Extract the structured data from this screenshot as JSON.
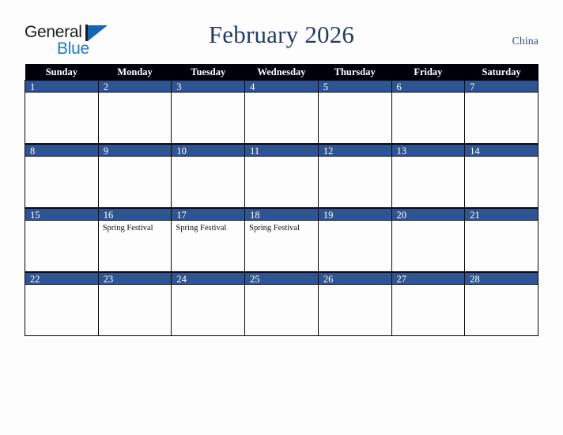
{
  "brand": {
    "word_one": "General",
    "word_two": "Blue",
    "mark_icon": "triangle-logo-icon",
    "color_dark": "#1b1b1b",
    "color_blue": "#1f7ac4",
    "mark_color": "#1565b0"
  },
  "header": {
    "title": "February 2026",
    "country": "China",
    "title_color": "#243b66",
    "country_color": "#3c4f74"
  },
  "calendar": {
    "weekday_headers": [
      "Sunday",
      "Monday",
      "Tuesday",
      "Wednesday",
      "Thursday",
      "Friday",
      "Saturday"
    ],
    "header_bg": "#00000a",
    "header_text_color": "#ffffff",
    "day_band_bg": "#2e5494",
    "day_band_text_color": "#ffffff",
    "cell_bg": "#fdfdfd",
    "border_color": "#0a0a0a",
    "weeks": [
      [
        {
          "day": "1",
          "events": []
        },
        {
          "day": "2",
          "events": []
        },
        {
          "day": "3",
          "events": []
        },
        {
          "day": "4",
          "events": []
        },
        {
          "day": "5",
          "events": []
        },
        {
          "day": "6",
          "events": []
        },
        {
          "day": "7",
          "events": []
        }
      ],
      [
        {
          "day": "8",
          "events": []
        },
        {
          "day": "9",
          "events": []
        },
        {
          "day": "10",
          "events": []
        },
        {
          "day": "11",
          "events": []
        },
        {
          "day": "12",
          "events": []
        },
        {
          "day": "13",
          "events": []
        },
        {
          "day": "14",
          "events": []
        }
      ],
      [
        {
          "day": "15",
          "events": []
        },
        {
          "day": "16",
          "events": [
            "Spring Festival"
          ]
        },
        {
          "day": "17",
          "events": [
            "Spring Festival"
          ]
        },
        {
          "day": "18",
          "events": [
            "Spring Festival"
          ]
        },
        {
          "day": "19",
          "events": []
        },
        {
          "day": "20",
          "events": []
        },
        {
          "day": "21",
          "events": []
        }
      ],
      [
        {
          "day": "22",
          "events": []
        },
        {
          "day": "23",
          "events": []
        },
        {
          "day": "24",
          "events": []
        },
        {
          "day": "25",
          "events": []
        },
        {
          "day": "26",
          "events": []
        },
        {
          "day": "27",
          "events": []
        },
        {
          "day": "28",
          "events": []
        }
      ]
    ]
  }
}
